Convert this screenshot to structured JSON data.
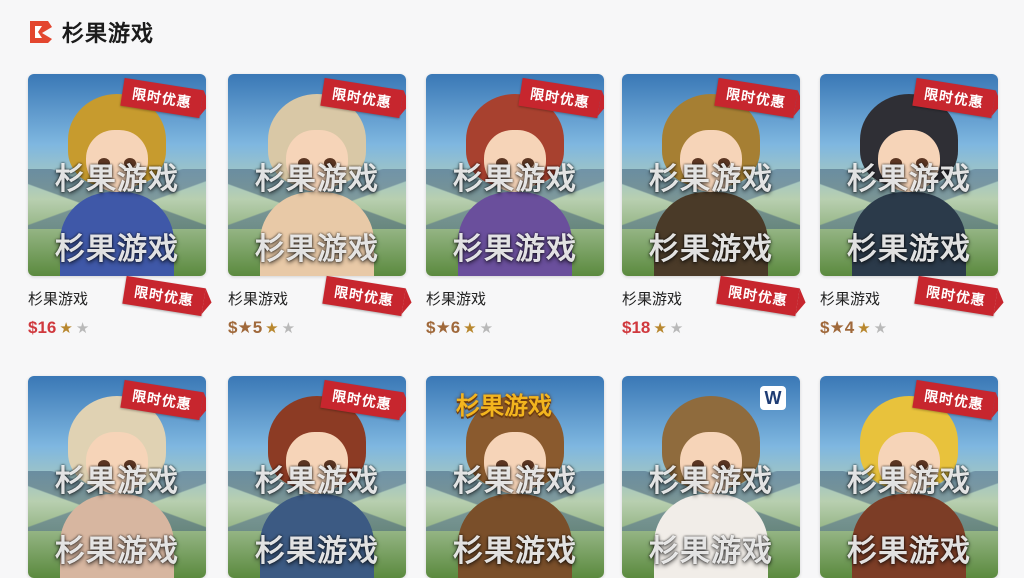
{
  "app": {
    "title": "杉果游戏"
  },
  "grid": {
    "cards": [
      {
        "badge": "限时优惠",
        "watermark": "杉果游戏",
        "title": "杉果游戏",
        "badge2": "限时优惠",
        "price": "$16",
        "stars": [
          1,
          0
        ],
        "hair": "#c79b2e",
        "body": "#3f58a8"
      },
      {
        "badge": "限时优惠",
        "watermark": "杉果游戏",
        "title": "杉果游戏",
        "badge2": "限时优惠",
        "price": "$★5",
        "stars": [
          1,
          0
        ],
        "hair": "#d9c8a6",
        "body": "#e8c9a7"
      },
      {
        "badge": "限时优惠",
        "watermark": "杉果游戏",
        "title": "杉果游戏",
        "badge2": "",
        "price": "$★6",
        "stars": [
          1,
          0
        ],
        "hair": "#a8412f",
        "body": "#6a4f9c"
      },
      {
        "badge": "限时优惠",
        "watermark": "杉果游戏",
        "title": "杉果游戏",
        "badge2": "限时优惠",
        "price": "$18",
        "stars": [
          1,
          0
        ],
        "hair": "#a67f33",
        "body": "#4a3a28"
      },
      {
        "badge": "限时优惠",
        "watermark": "杉果游戏",
        "title": "杉果游戏",
        "badge2": "限时优惠",
        "price": "$★4",
        "stars": [
          1,
          0
        ],
        "hair": "#2f2f35",
        "body": "#2b3a4a"
      },
      {
        "badge": "限时优惠",
        "watermark": "杉果游戏",
        "hair": "#e0d2b3",
        "body": "#d7b6a0"
      },
      {
        "badge": "限时优惠",
        "watermark": "杉果游戏",
        "hair": "#8c3b24",
        "body": "#3c5a83"
      },
      {
        "badge": "",
        "watermark": "杉果游戏",
        "game_logo": "杉果游戏",
        "hair": "#8a5a2e",
        "body": "#7a4f2a"
      },
      {
        "badge": "",
        "watermark": "杉果游戏",
        "corner_icon": "W",
        "hair": "#8f6b3d",
        "body": "#f1ede8"
      },
      {
        "badge": "限时优惠",
        "watermark": "杉果游戏",
        "hair": "#e8c23c",
        "body": "#7c3d26"
      }
    ]
  }
}
